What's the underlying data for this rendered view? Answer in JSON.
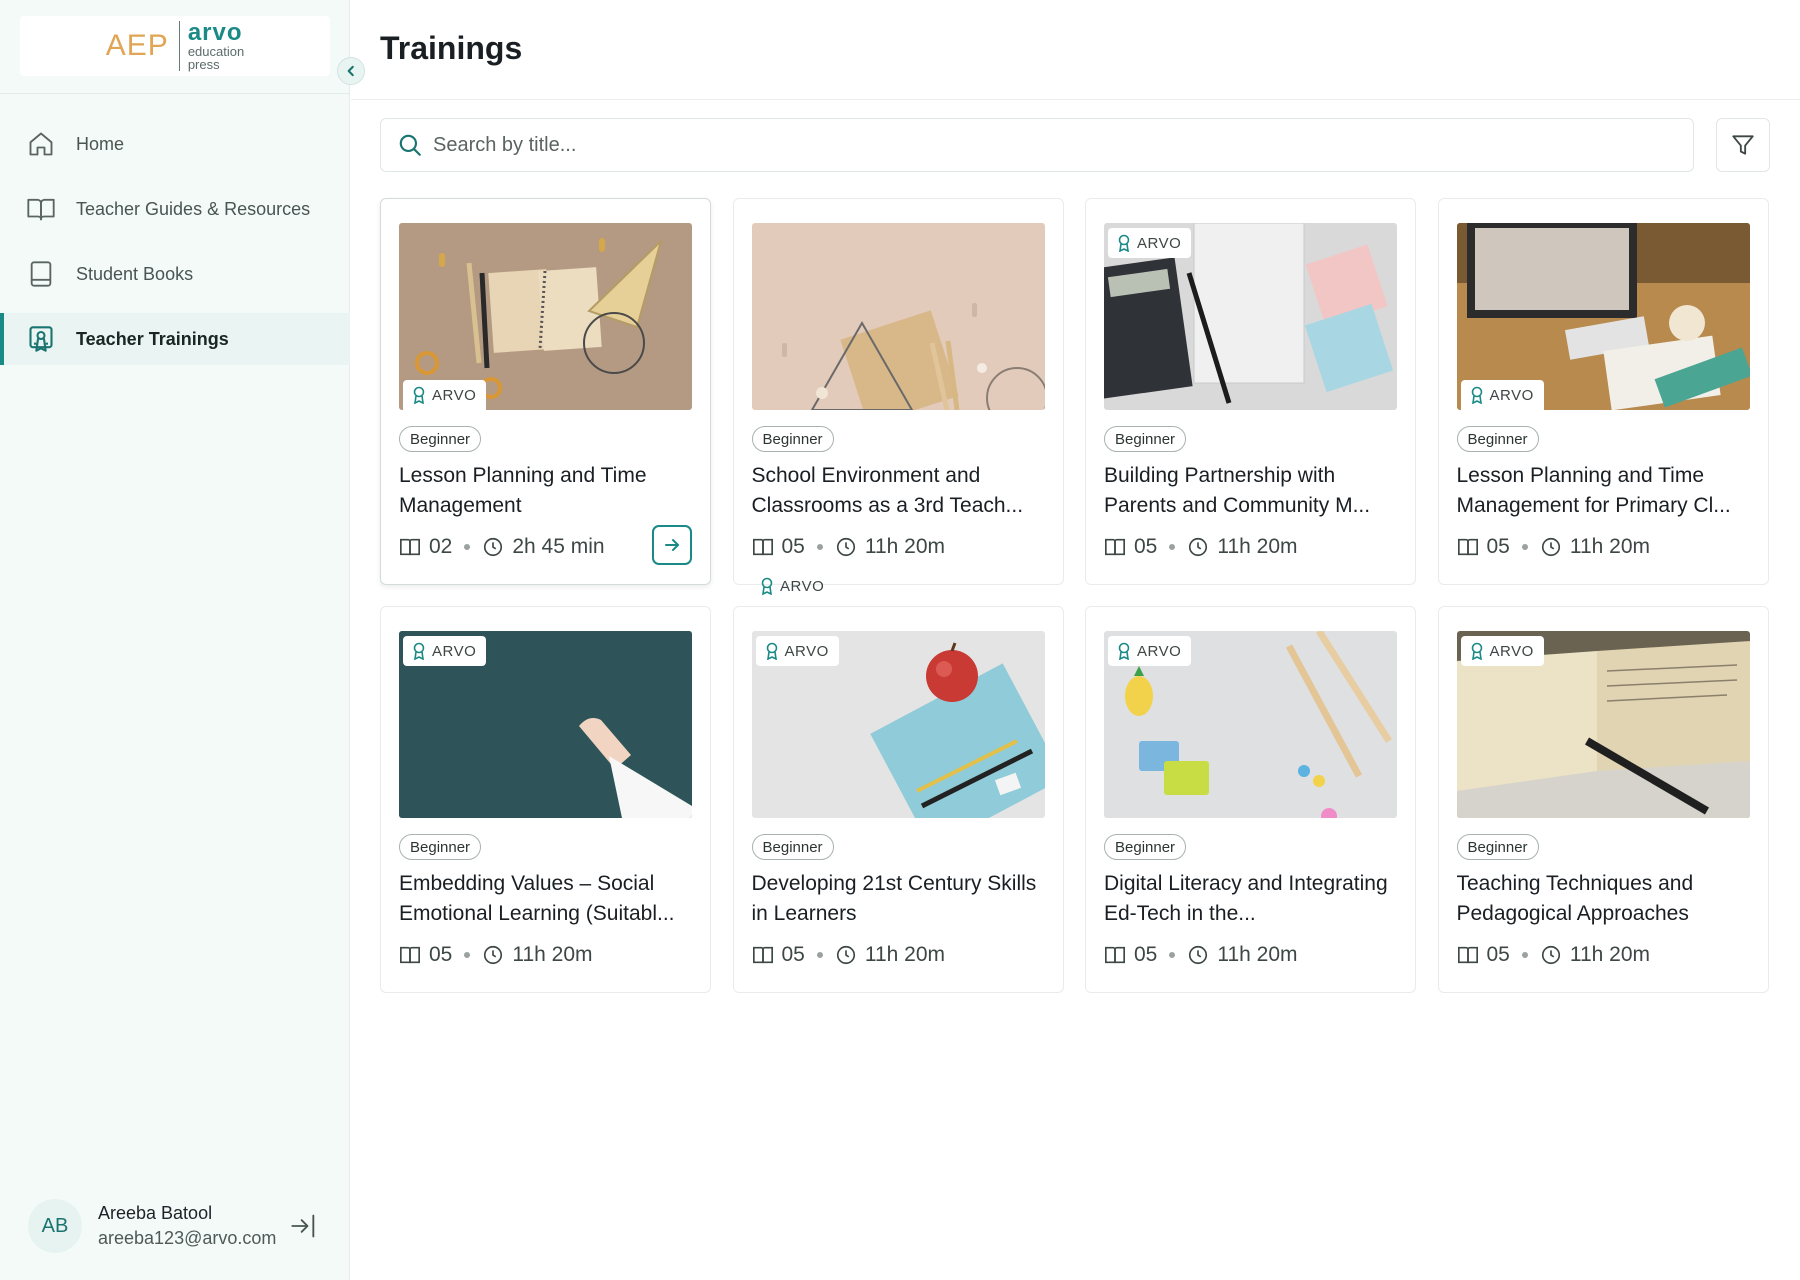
{
  "brand": {
    "left": "AEP",
    "right": "arvo",
    "sub1": "education",
    "sub2": "press"
  },
  "sidebar": {
    "items": [
      {
        "label": "Home",
        "icon": "home-icon"
      },
      {
        "label": "Teacher Guides & Resources",
        "icon": "open-book-icon"
      },
      {
        "label": "Student Books",
        "icon": "book-icon"
      },
      {
        "label": "Teacher Trainings",
        "icon": "certificate-icon"
      }
    ]
  },
  "user": {
    "initials": "AB",
    "name": "Areeba Batool",
    "email": "areeba123@arvo.com"
  },
  "page": {
    "title": "Trainings"
  },
  "search": {
    "placeholder": "Search by title..."
  },
  "floating_badge": "ARVO",
  "cards": [
    {
      "badge": "ARVO",
      "level": "Beginner",
      "title": "Lesson Planning and Time Management",
      "modules": "02",
      "duration": "2h 45 min"
    },
    {
      "badge": "",
      "level": "Beginner",
      "title": "School Environment and Classrooms as a 3rd Teach...",
      "modules": "05",
      "duration": "11h 20m"
    },
    {
      "badge": "ARVO",
      "level": "Beginner",
      "title": "Building Partnership with Parents and Community M...",
      "modules": "05",
      "duration": "11h 20m"
    },
    {
      "badge": "ARVO",
      "level": "Beginner",
      "title": "Lesson Planning and Time Management for Primary Cl...",
      "modules": "05",
      "duration": "11h 20m"
    },
    {
      "badge": "ARVO",
      "level": "Beginner",
      "title": "Embedding Values – Social Emotional Learning (Suitabl...",
      "modules": "05",
      "duration": "11h 20m"
    },
    {
      "badge": "ARVO",
      "level": "Beginner",
      "title": "Developing 21st Century Skills in Learners",
      "modules": "05",
      "duration": "11h 20m"
    },
    {
      "badge": "ARVO",
      "level": "Beginner",
      "title": "Digital Literacy and Integrating Ed-Tech in the...",
      "modules": "05",
      "duration": "11h 20m"
    },
    {
      "badge": "ARVO",
      "level": "Beginner",
      "title": "Teaching Techniques and Pedagogical Approaches",
      "modules": "05",
      "duration": "11h 20m"
    }
  ],
  "colors": {
    "accent": "#1a8a86",
    "sidebar_bg": "#f3faf8",
    "brand_orange": "#e0a655"
  }
}
